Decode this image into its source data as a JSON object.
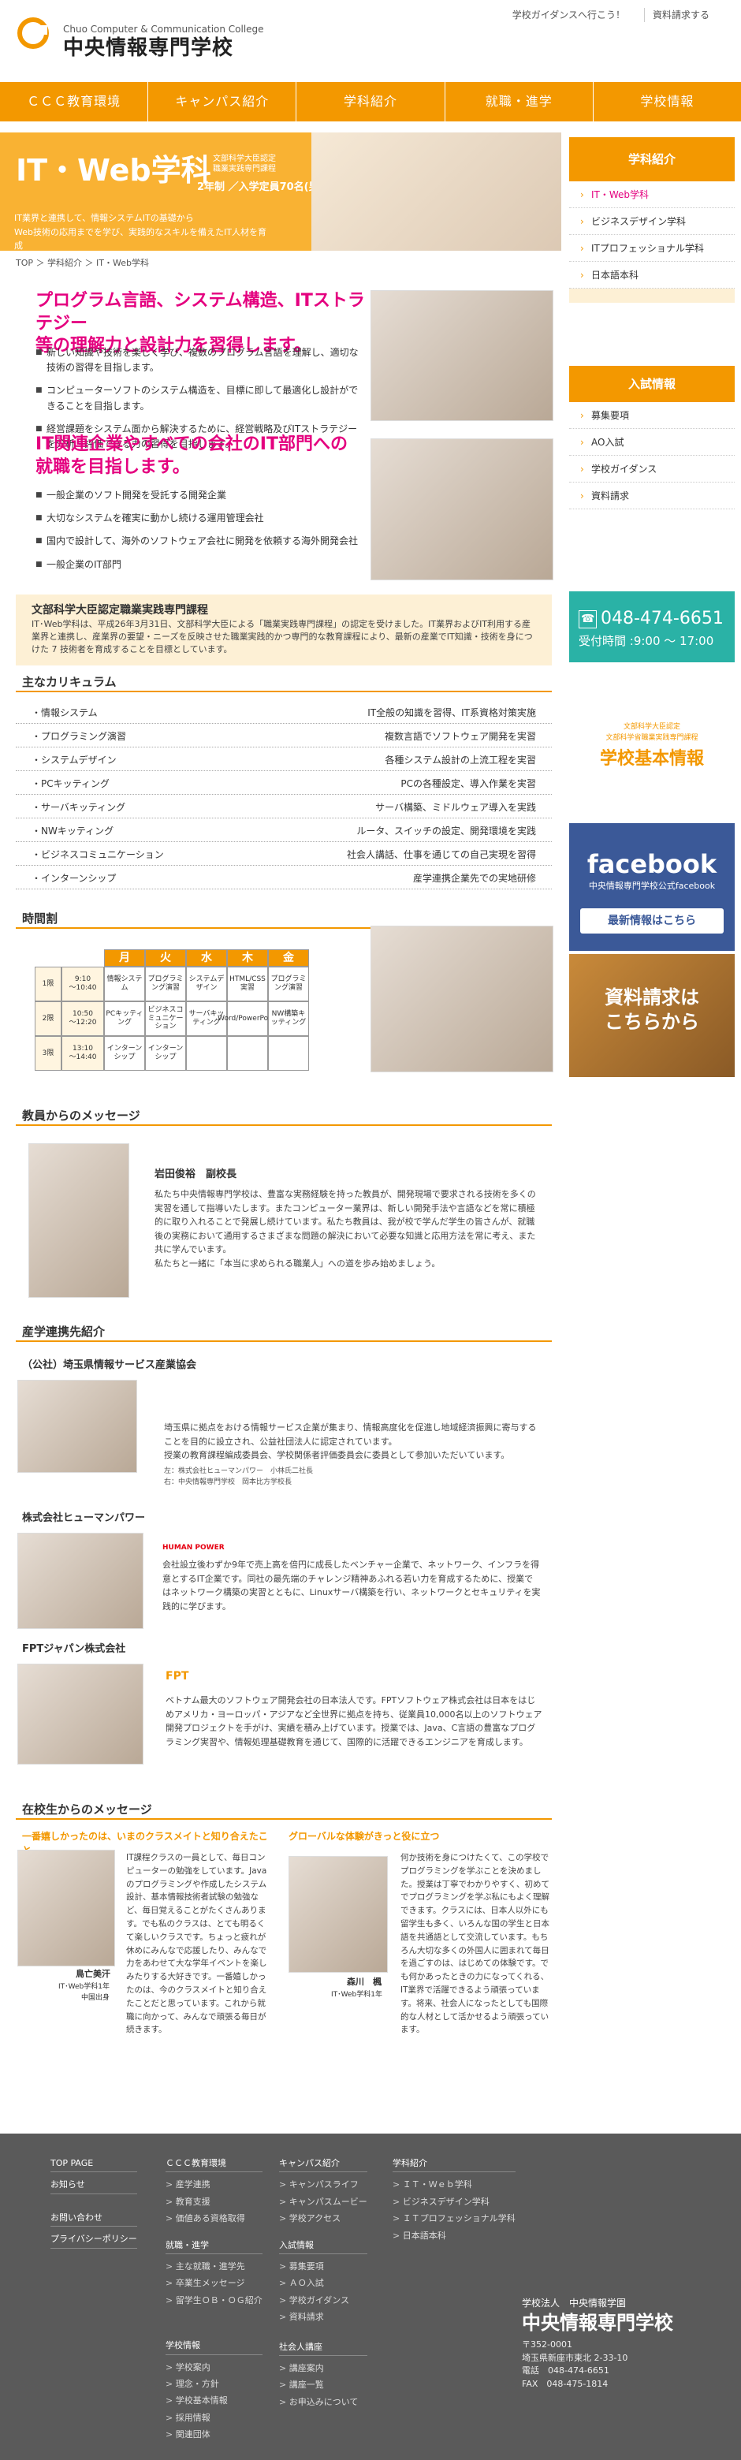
{
  "header": {
    "logo_sub": "Chuo Computer & Communication College",
    "logo_main": "中央情報専門学校",
    "util_links": [
      "学校ガイダンスへ行こう！",
      "資料請求する"
    ]
  },
  "nav": [
    "ＣＣＣ教育環境",
    "キャンパス紹介",
    "学科紹介",
    "就職・進学",
    "学校情報"
  ],
  "hero": {
    "title": "IT・Web学科",
    "note": "文部科学大臣認定\n職業実践専門課程",
    "years": "2年制 ／入学定員70名(男女)",
    "desc": "IT業界と連携して、情報システムITの基礎から\nWeb技術の応用までを学び、実践的なスキルを備えたIT人材を育成"
  },
  "breadcrumb": [
    "TOP",
    "学科紹介",
    "IT・Web学科"
  ],
  "section1": {
    "heading": "プログラム言語、システム構造、ITストラテジー\n等の理解力と設計力を習得します。",
    "items": [
      "新しい知識や技術を楽しく学び、複数のプログラム言語を理解し、適切な技術の習得を目指します。",
      "コンピューターソフトのシステム構造を、目標に即して最適化し設計ができることを目指します。",
      "経営課題をシステム面から解決するために、経営戦略及びITストラテジーを分析・評価できる力の習得を目指します。"
    ]
  },
  "section2": {
    "heading": "IT関連企業やすべての会社のIT部門への\n就職を目指します。",
    "items": [
      "一般企業のソフト開発を受託する開発企業",
      "大切なシステムを確実に動かし続ける運用管理会社",
      "国内で設計して、海外のソフトウェア会社に開発を依頼する海外開発会社",
      "一般企業のIT部門"
    ]
  },
  "mext": {
    "heading": "文部科学大臣認定職業実践専門課程",
    "text": "IT･Web学科は、平成26年3月31日、文部科学大臣による「職業実践専門課程」の認定を受けました。IT業界およびIT利用する産業界と連携し、産業界の要望・ニーズを反映させた職業実践的かつ専門的な教育課程により、最新の産業でIT知識・技術を身につけた 7 技術者を育成することを目標としています。"
  },
  "curriculum": {
    "heading": "主なカリキュラム",
    "rows": [
      {
        "name": "・情報システム",
        "desc": "IT全般の知識を習得、IT系資格対策実施"
      },
      {
        "name": "・プログラミング演習",
        "desc": "複数言語でソフトウェア開発を実習"
      },
      {
        "name": "・システムデザイン",
        "desc": "各種システム設計の上流工程を実習"
      },
      {
        "name": "・PCキッティング",
        "desc": "PCの各種設定、導入作業を実習"
      },
      {
        "name": "・サーバキッティング",
        "desc": "サーバ構築、ミドルウェア導入を実践"
      },
      {
        "name": "・NWキッティング",
        "desc": "ルータ、スイッチの設定、開発環境を実践"
      },
      {
        "name": "・ビジネスコミュニケーション",
        "desc": "社会人講話、仕事を通じての自己実現を習得"
      },
      {
        "name": "・インターンシップ",
        "desc": "産学連携企業先での実地研修"
      }
    ]
  },
  "timetable": {
    "heading": "時間割",
    "days": [
      "月",
      "火",
      "水",
      "木",
      "金"
    ],
    "periods": [
      {
        "label": "1限",
        "time": "9:10\n〜10:40",
        "cells": [
          "情報システム",
          "プログラミング演習",
          "システムデザイン",
          "HTML/CSS実習",
          "プログラミング演習"
        ]
      },
      {
        "label": "2限",
        "time": "10:50\n〜12:20",
        "cells": [
          "PCキッティング",
          "ビジネスコミュニケーション",
          "サーバキッティング",
          "Word/PowerPoint",
          "NW構築キッティング"
        ]
      },
      {
        "label": "3限",
        "time": "13:10\n〜14:40",
        "cells": [
          "インターンシップ",
          "インターンシップ",
          "",
          "",
          ""
        ]
      }
    ]
  },
  "teacher": {
    "heading": "教員からのメッセージ",
    "name": "岩田俊裕　副校長",
    "text": "私たち中央情報専門学校は、豊富な実務経験を持った教員が、開発現場で要求される技術を多くの実習を通して指導いたします。またコンピューター業界は、新しい開発手法や言語などを常に積極的に取り入れることで発展し続けています。私たち教員は、我が校で学んだ学生の皆さんが、就職後の実務において通用するさまざまな問題の解決において必要な知識と応用方法を常に考え、また共に学んでいます。\n私たちと一緒に「本当に求められる職業人」への道を歩み始めましょう。"
  },
  "industry": {
    "heading": "産学連携先紹介",
    "companies": [
      {
        "name": "（公社）埼玉県情報サービス産業協会",
        "text": "埼玉県に拠点をおける情報サービス企業が集まり、情報高度化を促進し地域経済振興に寄与することを目的に設立され、公益社団法人に認定されています。\n授業の教育課程編成委員会、学校関係者評価委員会に委員として参加いただいています。",
        "caption": "左：株式会社ヒューマンパワー　小林氏二社長\n右：中央情報専門学校　岡本比方学校長"
      },
      {
        "name": "株式会社ヒューマンパワー",
        "text": "会社設立後わずか9年で売上高を倍円に成長したベンチャー企業で、ネットワーク、インフラを得意とするIT企業です。同社の最先端のチャレンジ精神あふれる若い力を育成するために、授業ではネットワーク構築の実習とともに、Linuxサーバ構築を行い、ネットワークとセキュリティを実践的に学びます。",
        "logo": "HUMAN POWER"
      },
      {
        "name": "FPTジャパン株式会社",
        "text": "ベトナム最大のソフトウェア開発会社の日本法人です。FPTソフトウェア株式会社は日本をはじめアメリカ・ヨーロッパ・アジアなど全世界に拠点を持ち、従業員10,000名以上のソフトウェア開発プロジェクトを手がけ、実績を積み上げています。授業では、Java、C言語の豊富なプログラミング実習や、情報処理基礎教育を通じて、国際的に活躍できるエンジニアを育成します。",
        "logo": "FPT"
      }
    ]
  },
  "students": {
    "heading": "在校生からのメッセージ",
    "list": [
      {
        "title": "一番嬉しかったのは、いまのクラスメイトと知り合えたこと",
        "name": "鳥亡美汗",
        "class": "IT･Web学科1年\n中国出身",
        "text": "IT課程クラスの一員として、毎日コンピューターの勉強をしています。Javaのプログラミングや作成したシステム設計、基本情報技術者試験の勉強など、毎日覚えることがたくさんあります。でも私のクラスは、とても明るくて楽しいクラスです。ちょっと疲れが休めにみんなで応援したり、みんなで力をあわせて大な学年イベントを楽しみたりする大好きです。一番嬉しかったのは、今のクラスメイトと知り合えたことだと思っています。これから就職に向かって、みんなで頑張る毎日が続きます。"
      },
      {
        "title": "グローバルな体験がきっと役に立つ",
        "name": "森川　楓",
        "class": "IT･Web学科1年",
        "text": "何か技術を身につけたくて、この学校でプログラミングを学ぶことを決めました。授業は丁寧でわかりやすく、初めてでプログラミングを学ぶ私にもよく理解できます。クラスには、日本人以外にも留学生も多く、いろんな国の学生と日本語を共通語として交流しています。もちろん大切な多くの外国人に囲まれて毎日を過ごすのは、はじめての体験です。でも何かあったときの力になってくれる、IT業界で活躍できるよう頑張っています。将来、社会人になったとしても国際的な人材として活かせるよう頑張っています。"
      }
    ]
  },
  "sidebar": {
    "dept_title": "学科紹介",
    "dept_items": [
      "IT・Web学科",
      "ビジネスデザイン学科",
      "ITプロフェッショナル学科",
      "日本語本科"
    ],
    "adm_title": "入試情報",
    "adm_items": [
      "募集要項",
      "AO入試",
      "学校ガイダンス",
      "資料請求"
    ],
    "phone": "048-474-6651",
    "hours": "受付時間 :9:00 〜 17:00",
    "basic_small": "文部科学大臣認定\n文部科学省職業実践専門課程",
    "basic_main": "学校基本情報",
    "fb_title": "facebook",
    "fb_sub": "中央情報専門学校公式facebook",
    "fb_btn": "最新情報はこちら",
    "req_text": "資料請求は\nこちらから"
  },
  "footer": {
    "col1": [
      "TOP PAGE",
      "お知らせ",
      "",
      "お問い合わせ",
      "プライバシーポリシー"
    ],
    "col2_title": "ＣＣＣ教育環境",
    "col2": [
      "産学連携",
      "教育支援",
      "価値ある資格取得"
    ],
    "col3_title": "キャンパス紹介",
    "col3": [
      "キャンパスライフ",
      "キャンパスムービー",
      "学校アクセス"
    ],
    "col4_title": "学科紹介",
    "col4": [
      "ＩＴ・Ｗｅｂ学科",
      "ビジネスデザイン学科",
      "ＩＴプロフェッショナル学科",
      "日本語本科"
    ],
    "col5_title": "就職・進学",
    "col5": [
      "主な就職・進学先",
      "卒業生メッセージ",
      "留学生ＯＢ・ＯＧ紹介"
    ],
    "col6_title": "入試情報",
    "col6": [
      "募集要項",
      "ＡＯ入試",
      "学校ガイダンス",
      "資料請求"
    ],
    "col7_title": "学校情報",
    "col7": [
      "学校案内",
      "理念・方針",
      "学校基本情報",
      "採用情報",
      "関連団体"
    ],
    "col8_title": "社会人講座",
    "col8": [
      "講座案内",
      "講座一覧",
      "お申込みについて"
    ],
    "corp": "学校法人　中央情報学園",
    "school": "中央情報専門学校",
    "zip": "〒352-0001",
    "addr": "埼玉県新座市東北 2-33-10",
    "tel": "電話　048-474-6651",
    "fax": "FAX　048-475-1814"
  }
}
